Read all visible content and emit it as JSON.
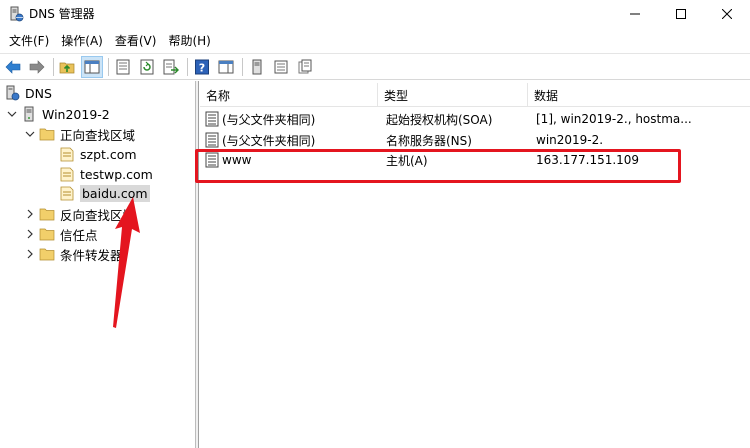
{
  "window": {
    "title": "DNS 管理器",
    "icon": "dns-manager-icon"
  },
  "menu": [
    "文件(F)",
    "操作(A)",
    "查看(V)",
    "帮助(H)"
  ],
  "toolbar": {
    "buttons": [
      "back-icon",
      "forward-icon",
      "up-folder-icon",
      "console-tree-icon",
      "properties-icon",
      "refresh-icon",
      "export-list-icon",
      "help-icon",
      "show-pane-icon",
      "new-server-icon",
      "new-record-icon",
      "copy-icon"
    ]
  },
  "tree": {
    "root": "DNS",
    "server": "Win2019-2",
    "forward_zone": "正向查找区域",
    "zones": [
      "szpt.com",
      "testwp.com",
      "baidu.com"
    ],
    "reverse_zone": "反向查找区域",
    "trust_points": "信任点",
    "conditional_forwarders": "条件转发器",
    "selected": "baidu.com"
  },
  "list": {
    "columns": [
      "名称",
      "类型",
      "数据"
    ],
    "rows": [
      {
        "name": "(与父文件夹相同)",
        "type": "起始授权机构(SOA)",
        "data": "[1], win2019-2., hostma..."
      },
      {
        "name": "(与父文件夹相同)",
        "type": "名称服务器(NS)",
        "data": "win2019-2."
      },
      {
        "name": "www",
        "type": "主机(A)",
        "data": "163.177.151.109"
      }
    ]
  },
  "annotations": {
    "highlight_color": "#e4151f",
    "highlighted_row": "www"
  }
}
